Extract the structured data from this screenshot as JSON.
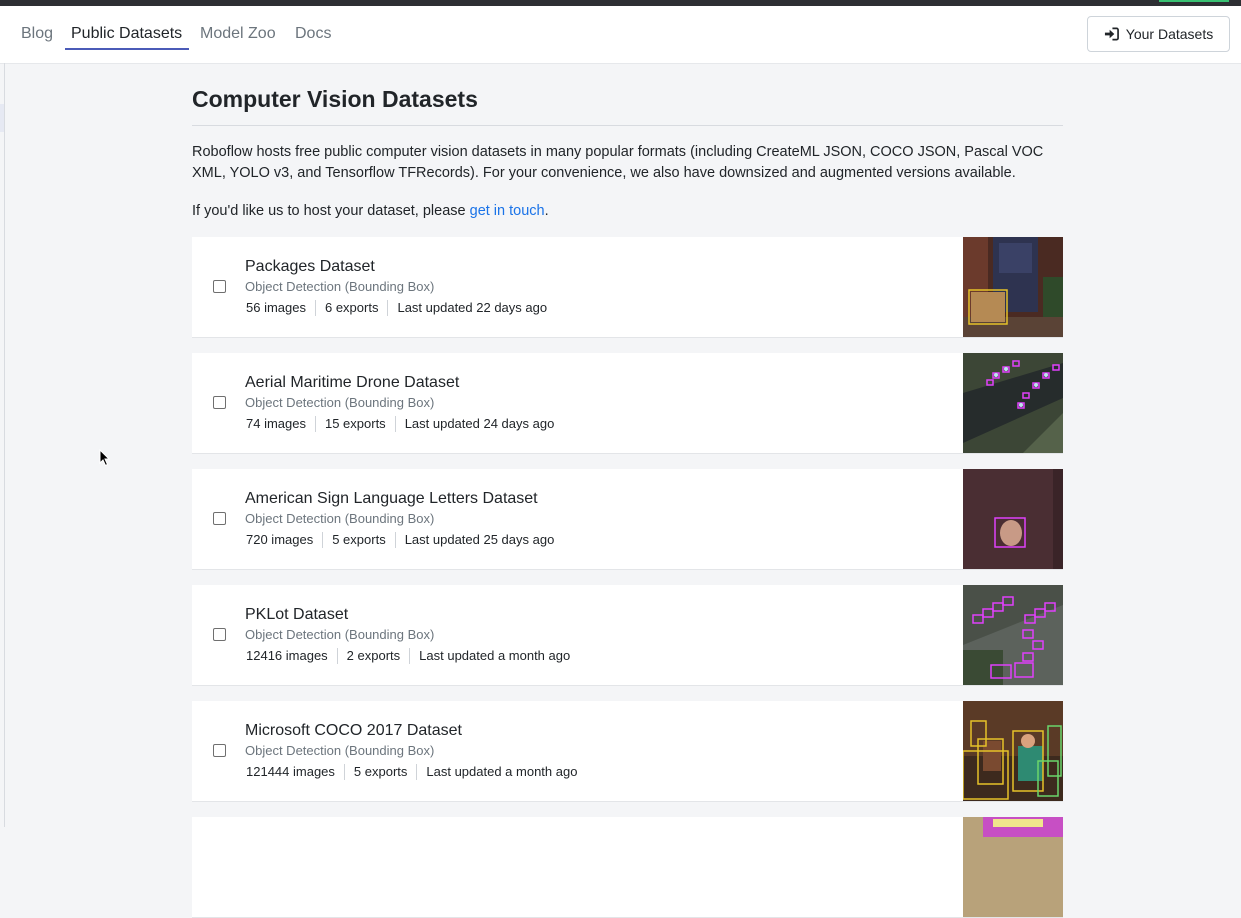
{
  "nav": {
    "tabs": [
      {
        "label": "Blog"
      },
      {
        "label": "Public Datasets",
        "active": true
      },
      {
        "label": "Model Zoo"
      },
      {
        "label": "Docs"
      }
    ],
    "your_datasets_label": "Your Datasets",
    "your_datasets_icon": "sign-in-icon"
  },
  "page": {
    "title": "Computer Vision Datasets",
    "intro": "Roboflow hosts free public computer vision datasets in many popular formats (including CreateML JSON, COCO JSON, Pascal VOC XML, YOLO v3, and Tensorflow TFRecords). For your convenience, we also have downsized and augmented versions available.",
    "host_prefix": "If you'd like us to host your dataset, please ",
    "host_link": "get in touch",
    "host_suffix": "."
  },
  "datasets": [
    {
      "name": "Packages Dataset",
      "type": "Object Detection (Bounding Box)",
      "images": "56 images",
      "exports": "6 exports",
      "updated": "Last updated 22 days ago"
    },
    {
      "name": "Aerial Maritime Drone Dataset",
      "type": "Object Detection (Bounding Box)",
      "images": "74 images",
      "exports": "15 exports",
      "updated": "Last updated 24 days ago"
    },
    {
      "name": "American Sign Language Letters Dataset",
      "type": "Object Detection (Bounding Box)",
      "images": "720 images",
      "exports": "5 exports",
      "updated": "Last updated 25 days ago"
    },
    {
      "name": "PKLot Dataset",
      "type": "Object Detection (Bounding Box)",
      "images": "12416 images",
      "exports": "2 exports",
      "updated": "Last updated a month ago"
    },
    {
      "name": "Microsoft COCO 2017 Dataset",
      "type": "Object Detection (Bounding Box)",
      "images": "121444 images",
      "exports": "5 exports",
      "updated": "Last updated a month ago"
    }
  ],
  "colors": {
    "link": "#1a73e8",
    "active_tab_underline": "#4b5bb8",
    "annotation_magenta": "#e040fb",
    "annotation_yellow": "#e6c229"
  }
}
